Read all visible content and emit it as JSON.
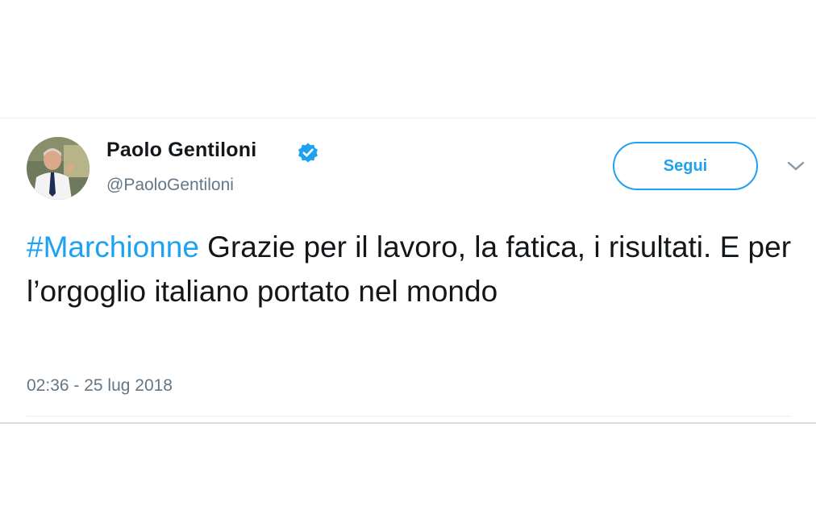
{
  "tweet": {
    "author": {
      "display_name": "Paolo Gentiloni",
      "handle": "@PaoloGentiloni",
      "verified": true,
      "avatar_icon": "profile-photo"
    },
    "follow_button_label": "Segui",
    "menu_icon": "chevron-down-icon",
    "text": {
      "hashtag": "#Marchionne",
      "body": " Grazie per il lavoro, la fatica, i risultati. E per l’orgoglio italiano portato nel mondo"
    },
    "timestamp": "02:36 - 25 lug 2018"
  },
  "colors": {
    "accent": "#1da1f2",
    "text_primary": "#14171a",
    "text_secondary": "#657786",
    "divider": "#e6ecf0"
  }
}
